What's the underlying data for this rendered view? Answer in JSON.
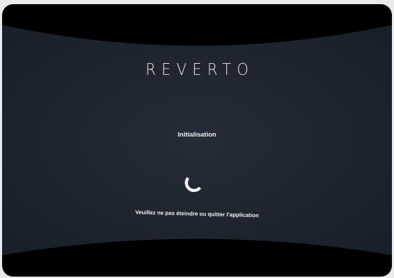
{
  "screen": {
    "logo": "REVERTO",
    "status": "Initialisation",
    "notice": "Veuillez ne pas éteindre ou quitter l'application"
  },
  "colors": {
    "panel": "#1f2530",
    "frame": "#000000",
    "text": "#f1f2f4",
    "background": "#e9eaec"
  },
  "icons": {
    "spinner": "loading-spinner-icon"
  }
}
